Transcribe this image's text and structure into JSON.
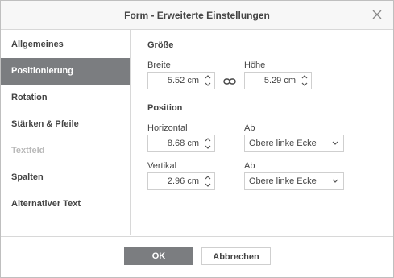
{
  "dialog": {
    "title": "Form - Erweiterte Einstellungen"
  },
  "sidebar": {
    "items": [
      {
        "label": "Allgemeines"
      },
      {
        "label": "Positionierung"
      },
      {
        "label": "Rotation"
      },
      {
        "label": "Stärken & Pfeile"
      },
      {
        "label": "Textfeld"
      },
      {
        "label": "Spalten"
      },
      {
        "label": "Alternativer Text"
      }
    ],
    "active": "Positionierung",
    "disabled": "Textfeld"
  },
  "size": {
    "heading": "Größe",
    "width_label": "Breite",
    "width_value": "5.52 cm",
    "height_label": "Höhe",
    "height_value": "5.29 cm"
  },
  "position": {
    "heading": "Position",
    "horizontal_label": "Horizontal",
    "horizontal_value": "8.68 cm",
    "horizontal_from_label": "Ab",
    "horizontal_from_value": "Obere linke Ecke",
    "vertical_label": "Vertikal",
    "vertical_value": "2.96 cm",
    "vertical_from_label": "Ab",
    "vertical_from_value": "Obere linke Ecke"
  },
  "footer": {
    "ok_label": "OK",
    "cancel_label": "Abbrechen"
  },
  "colors": {
    "accent": "#7b7d80",
    "border": "#cfcfcf"
  }
}
